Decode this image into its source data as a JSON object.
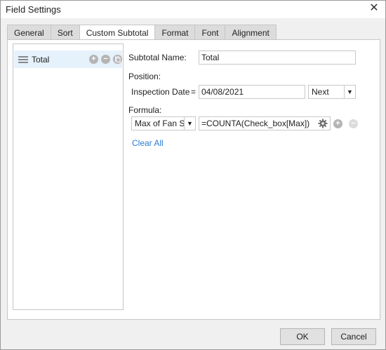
{
  "window": {
    "title": "Field Settings",
    "close_glyph": "✕"
  },
  "tabs": [
    {
      "label": "General"
    },
    {
      "label": "Sort"
    },
    {
      "label": "Custom Subtotal"
    },
    {
      "label": "Format"
    },
    {
      "label": "Font"
    },
    {
      "label": "Alignment"
    }
  ],
  "active_tab": "Custom Subtotal",
  "subtotal_list": {
    "items": [
      {
        "label": "Total"
      }
    ],
    "add_glyph": "+",
    "remove_glyph": "−"
  },
  "form": {
    "subtotal_name_label": "Subtotal Name:",
    "subtotal_name_value": "Total",
    "position_label": "Position:",
    "position_field": "Inspection Date",
    "equals": "=",
    "position_value": "04/08/2021",
    "position_mode": "Next",
    "formula_label": "Formula:",
    "formula_field": "Max of Fan Stat…",
    "formula_value": "=COUNTA(Check_box[Max])",
    "clear_all": "Clear All",
    "add_glyph": "+",
    "remove_glyph": "−"
  },
  "footer": {
    "ok": "OK",
    "cancel": "Cancel"
  },
  "colors": {
    "accent": "#2b7cd3",
    "selection": "#e5f1fb"
  }
}
